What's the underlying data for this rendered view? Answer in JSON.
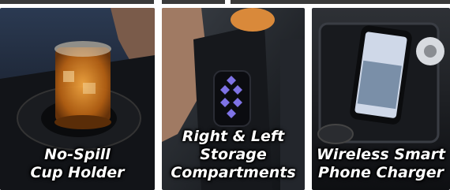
{
  "features": [
    {
      "line1": "No-Spill",
      "line2": "Cup Holder",
      "line3": ""
    },
    {
      "line1": "Right & Left",
      "line2": "Storage",
      "line3": "Compartments"
    },
    {
      "line1": "Wireless Smart",
      "line2": "Phone Charger",
      "line3": ""
    }
  ]
}
